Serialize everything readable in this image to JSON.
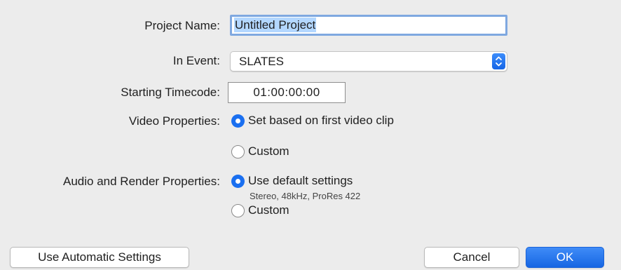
{
  "labels": {
    "project_name": "Project Name:",
    "in_event": "In Event:",
    "starting_timecode": "Starting Timecode:",
    "video_properties": "Video Properties:",
    "audio_render_properties": "Audio and Render Properties:"
  },
  "project_name_field": {
    "value": "Untitled Project",
    "selected": true
  },
  "in_event_popup": {
    "selected": "SLATES",
    "icon": "up-down-chevron-icon"
  },
  "starting_timecode_field": {
    "value": "01:00:00:00"
  },
  "video_properties": {
    "options": [
      {
        "label": "Set based on first video clip",
        "checked": true
      },
      {
        "label": "Custom",
        "checked": false
      }
    ]
  },
  "audio_render_properties": {
    "options": [
      {
        "label": "Use default settings",
        "checked": true,
        "detail": "Stereo, 48kHz, ProRes 422"
      },
      {
        "label": "Custom",
        "checked": false
      }
    ]
  },
  "buttons": {
    "automatic": "Use Automatic Settings",
    "cancel": "Cancel",
    "ok": "OK"
  },
  "colors": {
    "accent": "#1a6ff0",
    "background": "#ececec",
    "selection": "#b3d7ff"
  }
}
